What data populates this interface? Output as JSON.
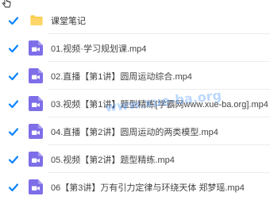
{
  "colors": {
    "checkbox": "#0a84ff",
    "folder": "#fccd4d",
    "video_icon": "#7e6ee8",
    "text": "#444444"
  },
  "files": [
    {
      "name": "课堂笔记",
      "type": "folder",
      "icon": "folder-icon",
      "checked": true
    },
    {
      "name": "01.视频·学习规划课.mp4",
      "type": "video",
      "icon": "video-file-icon",
      "checked": true
    },
    {
      "name": "02.直播【第1讲】圆周运动综合.mp4",
      "type": "video",
      "icon": "video-file-icon",
      "checked": true
    },
    {
      "name": "03.视频【第1讲】题型精练[学霸网www.xue-ba.org].mp4",
      "type": "video",
      "icon": "video-file-icon",
      "checked": true
    },
    {
      "name": "04.直播【第2讲】圆周运动的两类模型.mp4",
      "type": "video",
      "icon": "video-file-icon",
      "checked": true
    },
    {
      "name": "05.视频【第2讲】题型精练.mp4",
      "type": "video",
      "icon": "video-file-icon",
      "checked": true
    },
    {
      "name": "06【第3讲】万有引力定律与环绕天体 郑梦瑶.mp4",
      "type": "video",
      "icon": "video-file-icon",
      "checked": true
    }
  ],
  "watermark": "www.xue-ba.org"
}
